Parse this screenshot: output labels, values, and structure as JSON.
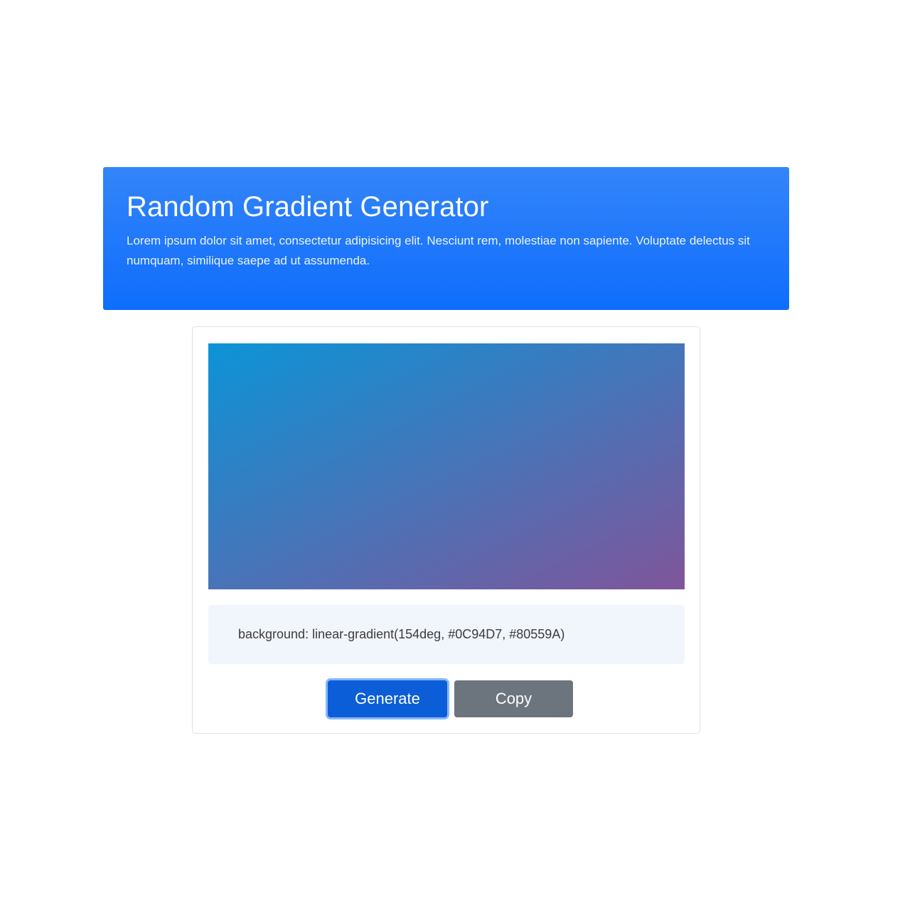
{
  "header": {
    "title": "Random Gradient Generator",
    "lead": "Lorem ipsum dolor sit amet, consectetur adipisicing elit. Nesciunt rem, molestiae non sapiente. Voluptate delectus sit numquam, similique saepe ad ut assumenda."
  },
  "gradient": {
    "angle": "154deg",
    "color1": "#0C94D7",
    "color2": "#80559A",
    "css_text": "background: linear-gradient(154deg, #0C94D7, #80559A)"
  },
  "buttons": {
    "generate_label": "Generate",
    "copy_label": "Copy"
  },
  "colors": {
    "primary": "#0d6efd",
    "primary_active": "#0b5ed7",
    "secondary": "#6c757d",
    "code_background": "#f1f5fc"
  }
}
